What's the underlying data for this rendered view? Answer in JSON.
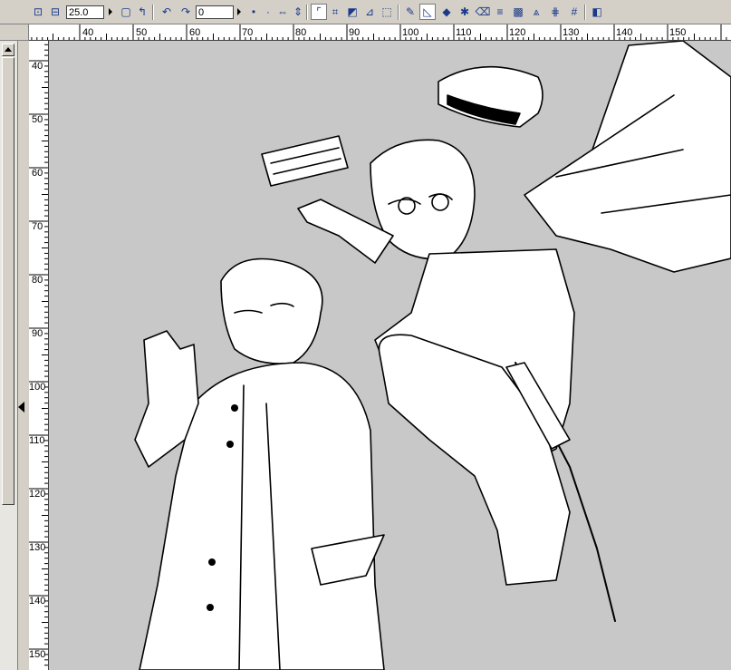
{
  "toolbar": {
    "zoom_value": "25.0",
    "rotation_value": "0",
    "tools": [
      {
        "name": "new-layer-icon",
        "glyph": "⊡"
      },
      {
        "name": "layer-icon",
        "glyph": "⊟"
      },
      {
        "name": "page-icon",
        "glyph": "▢"
      },
      {
        "name": "corner-icon",
        "glyph": "↰"
      },
      {
        "name": "rotate-left-icon",
        "glyph": "↶"
      },
      {
        "name": "rotate-right-icon",
        "glyph": "↷"
      },
      {
        "name": "dot-small-icon",
        "glyph": "•"
      },
      {
        "name": "dot-tiny-icon",
        "glyph": "·"
      },
      {
        "name": "flip-horizontal-icon",
        "glyph": "⇔"
      },
      {
        "name": "flip-vertical-icon",
        "glyph": "⇕"
      },
      {
        "name": "corner-select-icon",
        "glyph": "⌜"
      },
      {
        "name": "crop-icon",
        "glyph": "⌗"
      },
      {
        "name": "transform-icon",
        "glyph": "◩"
      },
      {
        "name": "ruler-tool-icon",
        "glyph": "⊿"
      },
      {
        "name": "selection-icon",
        "glyph": "⬚"
      },
      {
        "name": "pen-icon",
        "glyph": "✎"
      },
      {
        "name": "line-tool-icon",
        "glyph": "◺"
      },
      {
        "name": "fill-icon",
        "glyph": "◆"
      },
      {
        "name": "brush-icon",
        "glyph": "✱"
      },
      {
        "name": "eraser-icon",
        "glyph": "⌫"
      },
      {
        "name": "hatch-icon",
        "glyph": "≡"
      },
      {
        "name": "pattern-icon",
        "glyph": "▩"
      },
      {
        "name": "perspective-icon",
        "glyph": "⩓"
      },
      {
        "name": "grid-icon",
        "glyph": "⋕"
      },
      {
        "name": "grid-alt-icon",
        "glyph": "#"
      },
      {
        "name": "panel-toggle-icon",
        "glyph": "◧"
      }
    ]
  },
  "rulers": {
    "horizontal_labels": [
      "40",
      "50",
      "60",
      "70",
      "80",
      "90",
      "100",
      "110",
      "120",
      "130",
      "140",
      "150"
    ],
    "vertical_labels": [
      "40",
      "50",
      "60",
      "70",
      "80",
      "90",
      "100",
      "110",
      "120",
      "130",
      "140",
      "150"
    ]
  },
  "canvas": {
    "background": "#c8c8c8"
  }
}
